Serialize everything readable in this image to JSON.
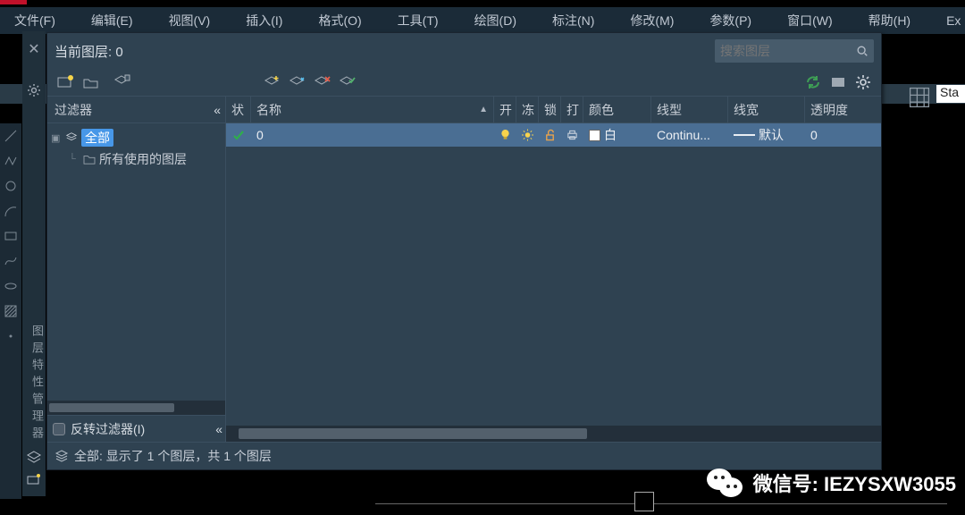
{
  "menubar": {
    "items": [
      "文件(F)",
      "编辑(E)",
      "视图(V)",
      "插入(I)",
      "格式(O)",
      "工具(T)",
      "绘图(D)",
      "标注(N)",
      "修改(M)",
      "参数(P)",
      "窗口(W)",
      "帮助(H)",
      "Ex"
    ]
  },
  "toolbar2": {
    "sta": "Sta"
  },
  "layer_panel": {
    "title_prefix": "当前图层: ",
    "current_layer": "0",
    "search_placeholder": "搜索图层",
    "filter_header": "过滤器",
    "tree": {
      "root": "全部",
      "child": "所有使用的图层"
    },
    "invert_label": "反转过滤器(I)",
    "columns": {
      "state": "状",
      "name": "名称",
      "on": "开",
      "freeze": "冻",
      "lock": "锁",
      "plot": "打",
      "color": "颜色",
      "linetype": "线型",
      "lineweight": "线宽",
      "trans": "透明度"
    },
    "rows": [
      {
        "name": "0",
        "color_name": "白",
        "linetype": "Continu...",
        "lineweight": "默认",
        "trans": "0"
      }
    ],
    "status": "全部: 显示了 1 个图层，共 1 个图层"
  },
  "wechat": {
    "label_prefix": "微信号: ",
    "id": "IEZYSXW3055"
  }
}
